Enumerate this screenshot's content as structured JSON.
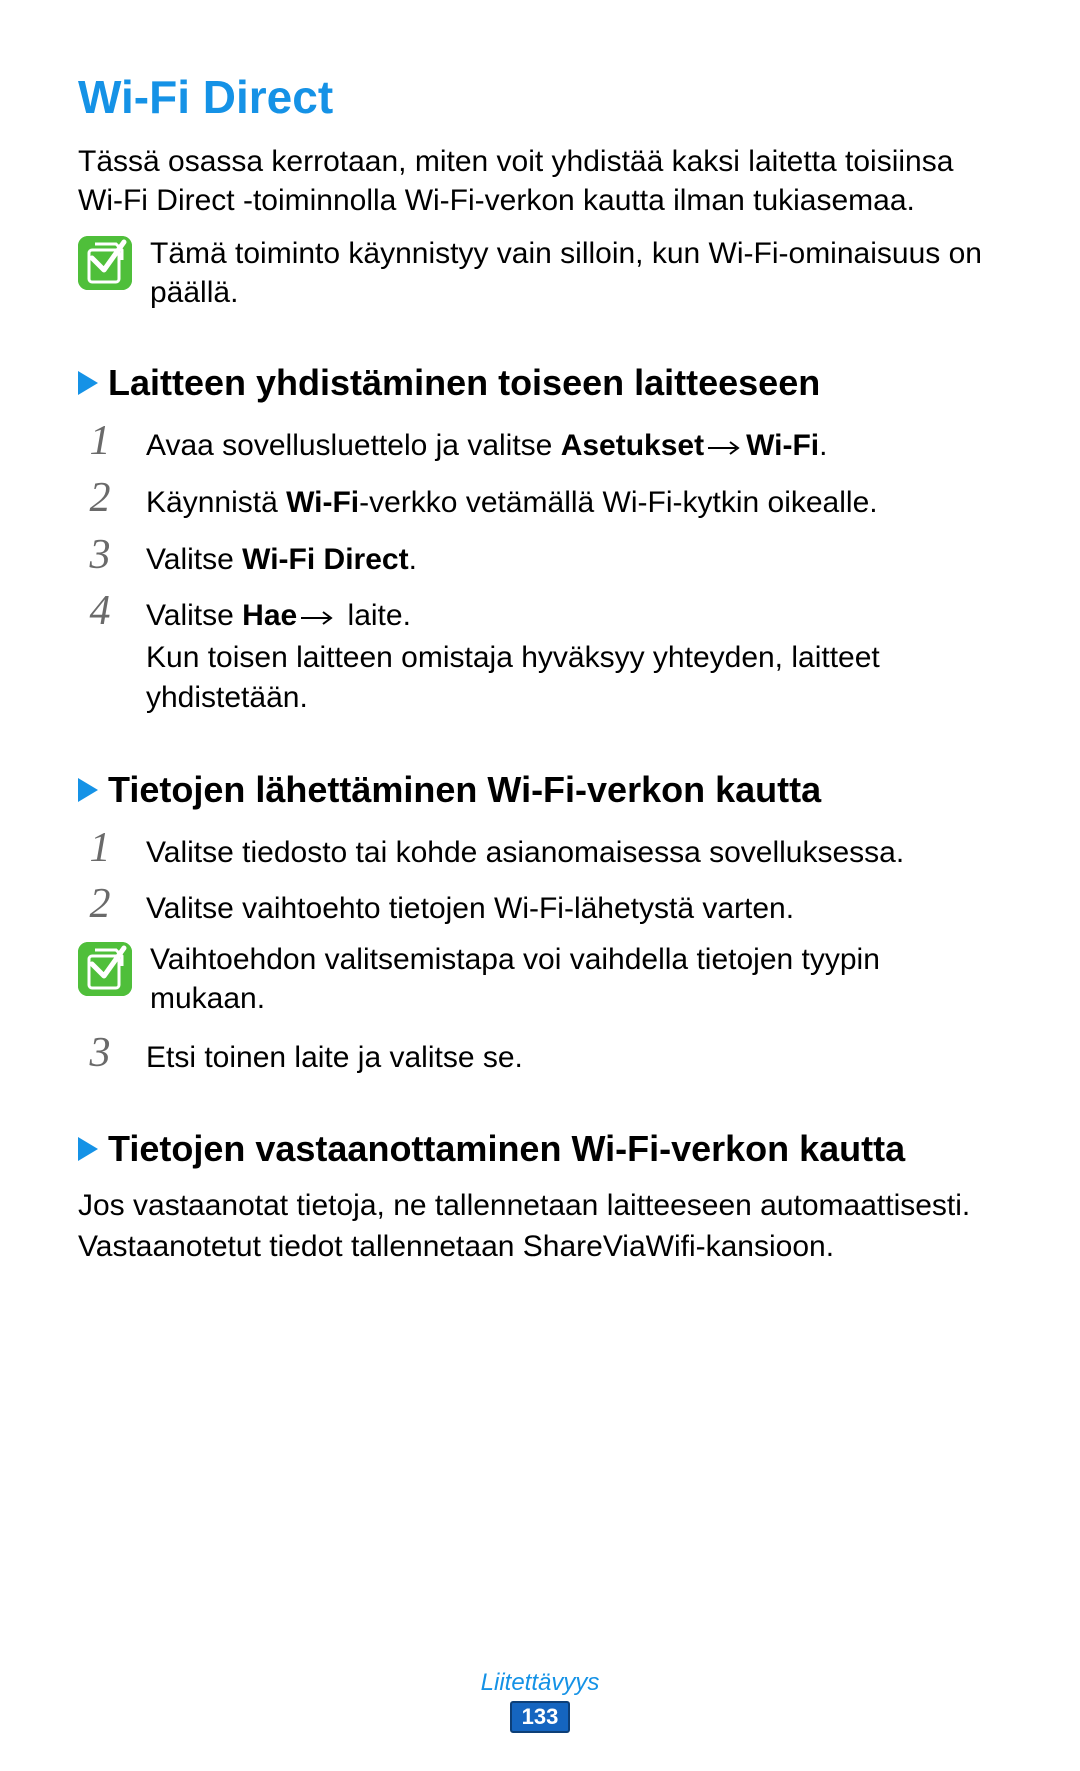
{
  "title": "Wi-Fi Direct",
  "intro": "Tässä osassa kerrotaan, miten voit yhdistää kaksi laitetta toisiinsa Wi-Fi Direct -toiminnolla Wi-Fi-verkon kautta ilman tukiasemaa.",
  "top_note": "Tämä toiminto käynnistyy vain silloin, kun Wi-Fi-ominaisuus on päällä.",
  "section1": {
    "heading": "Laitteen yhdistäminen toiseen laitteeseen",
    "steps": {
      "n1": "1",
      "s1_a": "Avaa sovellusluettelo ja valitse ",
      "s1_b1": "Asetukset",
      "s1_b2": "Wi-Fi",
      "s1_c": ".",
      "n2": "2",
      "s2_a": "Käynnistä ",
      "s2_b": "Wi-Fi",
      "s2_c": "-verkko vetämällä Wi-Fi-kytkin oikealle.",
      "n3": "3",
      "s3_a": "Valitse ",
      "s3_b": "Wi-Fi Direct",
      "s3_c": ".",
      "n4": "4",
      "s4_a": "Valitse ",
      "s4_b": "Hae",
      "s4_c": " laite.",
      "s4_extra": "Kun toisen laitteen omistaja hyväksyy yhteyden, laitteet yhdistetään."
    }
  },
  "section2": {
    "heading": "Tietojen lähettäminen Wi-Fi-verkon kautta",
    "steps": {
      "n1": "1",
      "s1": "Valitse tiedosto tai kohde asianomaisessa sovelluksessa.",
      "n2": "2",
      "s2": "Valitse vaihtoehto tietojen Wi-Fi-lähetystä varten.",
      "note": "Vaihtoehdon valitsemistapa voi vaihdella tietojen tyypin mukaan.",
      "n3": "3",
      "s3": "Etsi toinen laite ja valitse se."
    }
  },
  "section3": {
    "heading": "Tietojen vastaanottaminen Wi-Fi-verkon kautta",
    "body": "Jos vastaanotat tietoja, ne tallennetaan laitteeseen automaattisesti. Vastaanotetut tiedot tallennetaan ShareViaWifi-kansioon."
  },
  "footer": {
    "category": "Liitettävyys",
    "page": "133"
  }
}
